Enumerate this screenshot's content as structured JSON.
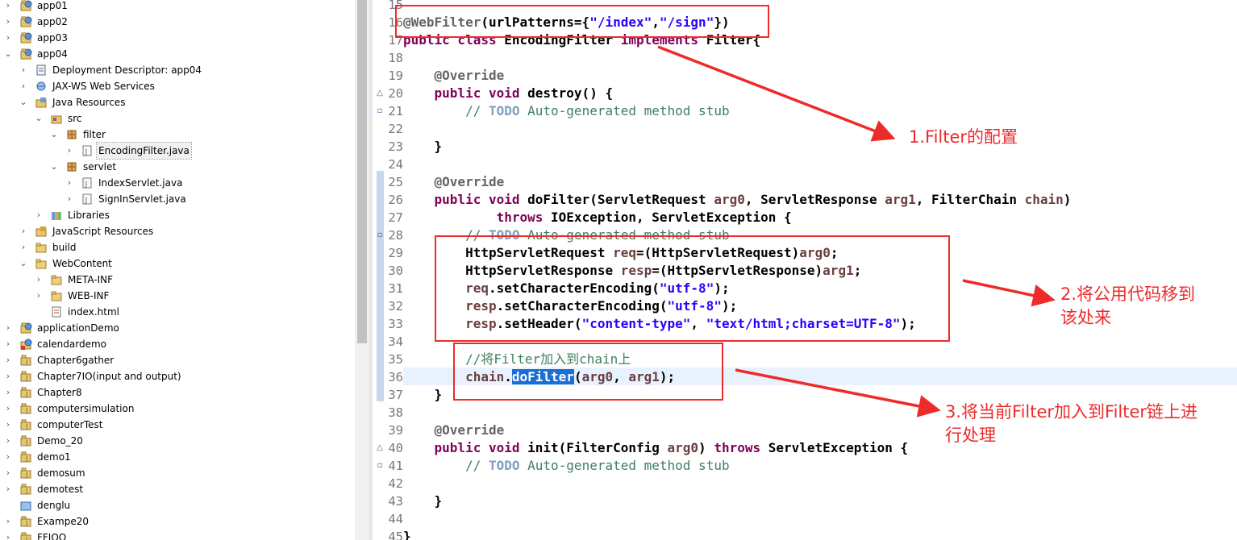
{
  "explorer": {
    "items": [
      {
        "label": "app01",
        "depth": 0,
        "expanded": false,
        "icon": "web-project-icon"
      },
      {
        "label": "app02",
        "depth": 0,
        "expanded": false,
        "icon": "web-project-icon"
      },
      {
        "label": "app03",
        "depth": 0,
        "expanded": false,
        "icon": "web-project-icon"
      },
      {
        "label": "app04",
        "depth": 0,
        "expanded": true,
        "icon": "web-project-icon"
      },
      {
        "label": "Deployment Descriptor: app04",
        "depth": 1,
        "expanded": false,
        "icon": "deployment-descriptor-icon"
      },
      {
        "label": "JAX-WS Web Services",
        "depth": 1,
        "expanded": false,
        "icon": "web-services-icon"
      },
      {
        "label": "Java Resources",
        "depth": 1,
        "expanded": true,
        "icon": "java-resources-icon"
      },
      {
        "label": "src",
        "depth": 2,
        "expanded": true,
        "icon": "source-folder-icon"
      },
      {
        "label": "filter",
        "depth": 3,
        "expanded": true,
        "icon": "package-icon"
      },
      {
        "label": "EncodingFilter.java",
        "depth": 4,
        "expanded": false,
        "icon": "java-file-icon",
        "selected": true
      },
      {
        "label": "servlet",
        "depth": 3,
        "expanded": true,
        "icon": "package-icon"
      },
      {
        "label": "IndexServlet.java",
        "depth": 4,
        "expanded": false,
        "icon": "java-file-icon"
      },
      {
        "label": "SignInServlet.java",
        "depth": 4,
        "expanded": false,
        "icon": "java-file-icon"
      },
      {
        "label": "Libraries",
        "depth": 2,
        "expanded": false,
        "icon": "libraries-icon"
      },
      {
        "label": "JavaScript Resources",
        "depth": 1,
        "expanded": false,
        "icon": "javascript-resources-icon"
      },
      {
        "label": "build",
        "depth": 1,
        "expanded": false,
        "icon": "folder-icon"
      },
      {
        "label": "WebContent",
        "depth": 1,
        "expanded": true,
        "icon": "folder-icon"
      },
      {
        "label": "META-INF",
        "depth": 2,
        "expanded": false,
        "icon": "folder-icon"
      },
      {
        "label": "WEB-INF",
        "depth": 2,
        "expanded": false,
        "icon": "folder-icon"
      },
      {
        "label": "index.html",
        "depth": 2,
        "expanded": null,
        "icon": "html-file-icon"
      },
      {
        "label": "applicationDemo",
        "depth": 0,
        "expanded": false,
        "icon": "web-project-icon"
      },
      {
        "label": "calendardemo",
        "depth": 0,
        "expanded": false,
        "icon": "web-project-error-icon"
      },
      {
        "label": "Chapter6gather",
        "depth": 0,
        "expanded": false,
        "icon": "java-project-icon"
      },
      {
        "label": "Chapter7IO(input and output)",
        "depth": 0,
        "expanded": false,
        "icon": "java-project-icon"
      },
      {
        "label": "Chapter8",
        "depth": 0,
        "expanded": false,
        "icon": "java-project-icon"
      },
      {
        "label": "computersimulation",
        "depth": 0,
        "expanded": false,
        "icon": "java-project-icon"
      },
      {
        "label": "computerTest",
        "depth": 0,
        "expanded": false,
        "icon": "java-project-icon"
      },
      {
        "label": "Demo_20",
        "depth": 0,
        "expanded": false,
        "icon": "java-project-icon"
      },
      {
        "label": "demo1",
        "depth": 0,
        "expanded": false,
        "icon": "java-project-icon"
      },
      {
        "label": "demosum",
        "depth": 0,
        "expanded": false,
        "icon": "java-project-icon"
      },
      {
        "label": "demotest",
        "depth": 0,
        "expanded": false,
        "icon": "java-project-icon"
      },
      {
        "label": "denglu",
        "depth": 0,
        "expanded": null,
        "icon": "closed-project-icon"
      },
      {
        "label": "Exampe20",
        "depth": 0,
        "expanded": false,
        "icon": "java-project-icon"
      },
      {
        "label": "FFIOO",
        "depth": 0,
        "expanded": false,
        "icon": "java-project-icon"
      }
    ]
  },
  "editor": {
    "lines": [
      {
        "n": "15",
        "fold": "",
        "segs": []
      },
      {
        "n": "16",
        "fold": "",
        "segs": [
          {
            "t": "@WebFilter",
            "c": "an"
          },
          {
            "t": "(urlPatterns={"
          },
          {
            "t": "\"/index\"",
            "c": "str"
          },
          {
            "t": ","
          },
          {
            "t": "\"/sign\"",
            "c": "str"
          },
          {
            "t": "})"
          }
        ]
      },
      {
        "n": "17",
        "fold": "",
        "segs": [
          {
            "t": "public class ",
            "c": "kw"
          },
          {
            "t": "EncodingFilter "
          },
          {
            "t": "implements ",
            "c": "kw"
          },
          {
            "t": "Filter{"
          }
        ]
      },
      {
        "n": "18",
        "fold": "",
        "segs": []
      },
      {
        "n": "19",
        "fold": "",
        "segs": [
          {
            "t": "    "
          },
          {
            "t": "@Override",
            "c": "an"
          }
        ]
      },
      {
        "n": "20",
        "fold": "override",
        "segs": [
          {
            "t": "    "
          },
          {
            "t": "public void ",
            "c": "kw"
          },
          {
            "t": "destroy() {"
          }
        ]
      },
      {
        "n": "21",
        "fold": "todo",
        "segs": [
          {
            "t": "        "
          },
          {
            "t": "// ",
            "c": "cm"
          },
          {
            "t": "TODO",
            "c": "todo"
          },
          {
            "t": " Auto-generated method stub",
            "c": "cm"
          }
        ]
      },
      {
        "n": "22",
        "fold": "",
        "segs": []
      },
      {
        "n": "23",
        "fold": "",
        "segs": [
          {
            "t": "    }"
          }
        ]
      },
      {
        "n": "24",
        "fold": "",
        "segs": []
      },
      {
        "n": "25",
        "fold": "",
        "segs": [
          {
            "t": "    "
          },
          {
            "t": "@Override",
            "c": "an"
          }
        ]
      },
      {
        "n": "26",
        "fold": "",
        "segs": [
          {
            "t": "    "
          },
          {
            "t": "public void ",
            "c": "kw"
          },
          {
            "t": "doFilter(ServletRequest "
          },
          {
            "t": "arg0",
            "c": "par"
          },
          {
            "t": ", ServletResponse "
          },
          {
            "t": "arg1",
            "c": "par"
          },
          {
            "t": ", FilterChain "
          },
          {
            "t": "chain",
            "c": "par"
          },
          {
            "t": ")"
          }
        ]
      },
      {
        "n": "27",
        "fold": "",
        "segs": [
          {
            "t": "            "
          },
          {
            "t": "throws ",
            "c": "kw"
          },
          {
            "t": "IOException, ServletException {"
          }
        ]
      },
      {
        "n": "28",
        "fold": "todo",
        "segs": [
          {
            "t": "        "
          },
          {
            "t": "// ",
            "c": "cm"
          },
          {
            "t": "TODO",
            "c": "todo"
          },
          {
            "t": " Auto-generated method stub",
            "c": "cm"
          }
        ]
      },
      {
        "n": "29",
        "fold": "",
        "segs": [
          {
            "t": "        HttpServletRequest "
          },
          {
            "t": "req",
            "c": "par"
          },
          {
            "t": "=(HttpServletRequest)"
          },
          {
            "t": "arg0",
            "c": "par"
          },
          {
            "t": ";"
          }
        ]
      },
      {
        "n": "30",
        "fold": "",
        "segs": [
          {
            "t": "        HttpServletResponse "
          },
          {
            "t": "resp",
            "c": "par"
          },
          {
            "t": "=(HttpServletResponse)"
          },
          {
            "t": "arg1",
            "c": "par"
          },
          {
            "t": ";"
          }
        ]
      },
      {
        "n": "31",
        "fold": "",
        "segs": [
          {
            "t": "        "
          },
          {
            "t": "req",
            "c": "par"
          },
          {
            "t": ".setCharacterEncoding("
          },
          {
            "t": "\"utf-8\"",
            "c": "str"
          },
          {
            "t": ");"
          }
        ]
      },
      {
        "n": "32",
        "fold": "",
        "segs": [
          {
            "t": "        "
          },
          {
            "t": "resp",
            "c": "par"
          },
          {
            "t": ".setCharacterEncoding("
          },
          {
            "t": "\"utf-8\"",
            "c": "str"
          },
          {
            "t": ");"
          }
        ]
      },
      {
        "n": "33",
        "fold": "",
        "segs": [
          {
            "t": "        "
          },
          {
            "t": "resp",
            "c": "par"
          },
          {
            "t": ".setHeader("
          },
          {
            "t": "\"content-type\"",
            "c": "str"
          },
          {
            "t": ", "
          },
          {
            "t": "\"text/html;charset=UTF-8\"",
            "c": "str"
          },
          {
            "t": ");"
          }
        ]
      },
      {
        "n": "34",
        "fold": "",
        "segs": []
      },
      {
        "n": "35",
        "fold": "",
        "segs": [
          {
            "t": "        "
          },
          {
            "t": "//将Filter加入到chain上",
            "c": "cm"
          }
        ]
      },
      {
        "n": "36",
        "fold": "",
        "segs": [
          {
            "t": "        "
          },
          {
            "t": "chain",
            "c": "par"
          },
          {
            "t": "."
          },
          {
            "t": "doFilter",
            "c": "hl"
          },
          {
            "t": "("
          },
          {
            "t": "arg0",
            "c": "par"
          },
          {
            "t": ", "
          },
          {
            "t": "arg1",
            "c": "par"
          },
          {
            "t": ");"
          }
        ]
      },
      {
        "n": "37",
        "fold": "",
        "segs": [
          {
            "t": "    }"
          }
        ]
      },
      {
        "n": "38",
        "fold": "",
        "segs": []
      },
      {
        "n": "39",
        "fold": "",
        "segs": [
          {
            "t": "    "
          },
          {
            "t": "@Override",
            "c": "an"
          }
        ]
      },
      {
        "n": "40",
        "fold": "override",
        "segs": [
          {
            "t": "    "
          },
          {
            "t": "public void ",
            "c": "kw"
          },
          {
            "t": "init(FilterConfig "
          },
          {
            "t": "arg0",
            "c": "par"
          },
          {
            "t": ") "
          },
          {
            "t": "throws ",
            "c": "kw"
          },
          {
            "t": "ServletException {"
          }
        ]
      },
      {
        "n": "41",
        "fold": "todo",
        "segs": [
          {
            "t": "        "
          },
          {
            "t": "// ",
            "c": "cm"
          },
          {
            "t": "TODO",
            "c": "todo"
          },
          {
            "t": " Auto-generated method stub",
            "c": "cm"
          }
        ]
      },
      {
        "n": "42",
        "fold": "",
        "segs": []
      },
      {
        "n": "43",
        "fold": "",
        "segs": [
          {
            "t": "    }"
          }
        ]
      },
      {
        "n": "44",
        "fold": "",
        "segs": []
      },
      {
        "n": "45",
        "fold": "",
        "segs": [
          {
            "t": "}"
          }
        ]
      }
    ]
  },
  "annotations": {
    "label1": "1.Filter的配置",
    "label2_line1": "2.将公用代码移到",
    "label2_line2": "该处来",
    "label3_line1": "3.将当前Filter加入到Filter链上进",
    "label3_line2": "行处理",
    "color": "#ee2b2b"
  }
}
